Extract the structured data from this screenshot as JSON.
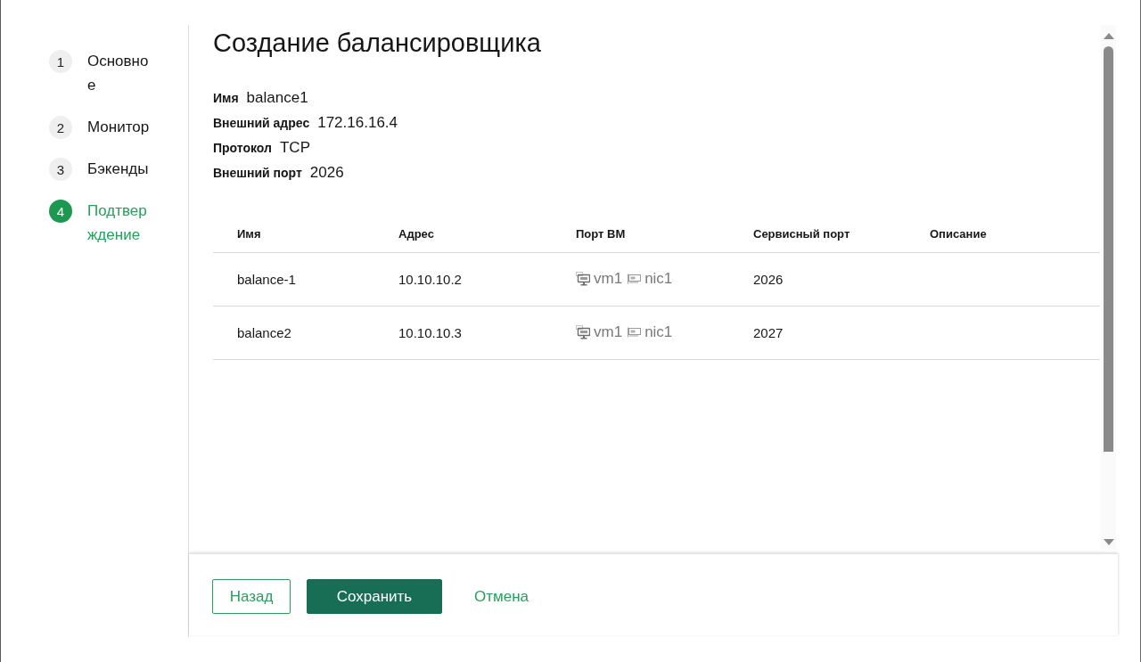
{
  "steps": [
    {
      "number": "1",
      "label": "Основное",
      "selected": false
    },
    {
      "number": "2",
      "label": "Монитор",
      "selected": false
    },
    {
      "number": "3",
      "label": "Бэкенды",
      "selected": false
    },
    {
      "number": "4",
      "label": "Подтверждение",
      "selected": true
    }
  ],
  "title": "Создание балансировщика",
  "summary": [
    {
      "label": "Имя",
      "value": "balance1"
    },
    {
      "label": "Внешний адрес",
      "value": "172.16.16.4"
    },
    {
      "label": "Протокол",
      "value": "TCP"
    },
    {
      "label": "Внешний порт",
      "value": "2026"
    }
  ],
  "table": {
    "columns": [
      "Имя",
      "Адрес",
      "Порт ВМ",
      "Сервисный порт",
      "Описание"
    ],
    "rows": [
      {
        "name": "balance-1",
        "address": "10.10.10.2",
        "vm": "vm1",
        "nic": "nic1",
        "service_port": "2026"
      },
      {
        "name": "balance2",
        "address": "10.10.10.3",
        "vm": "vm1",
        "nic": "nic1",
        "service_port": "2027"
      }
    ]
  },
  "buttons": [
    {
      "label": "Назад",
      "kind": "outline"
    },
    {
      "label": "Сохранить",
      "kind": "primary"
    },
    {
      "label": "Отмена",
      "kind": "link"
    }
  ]
}
